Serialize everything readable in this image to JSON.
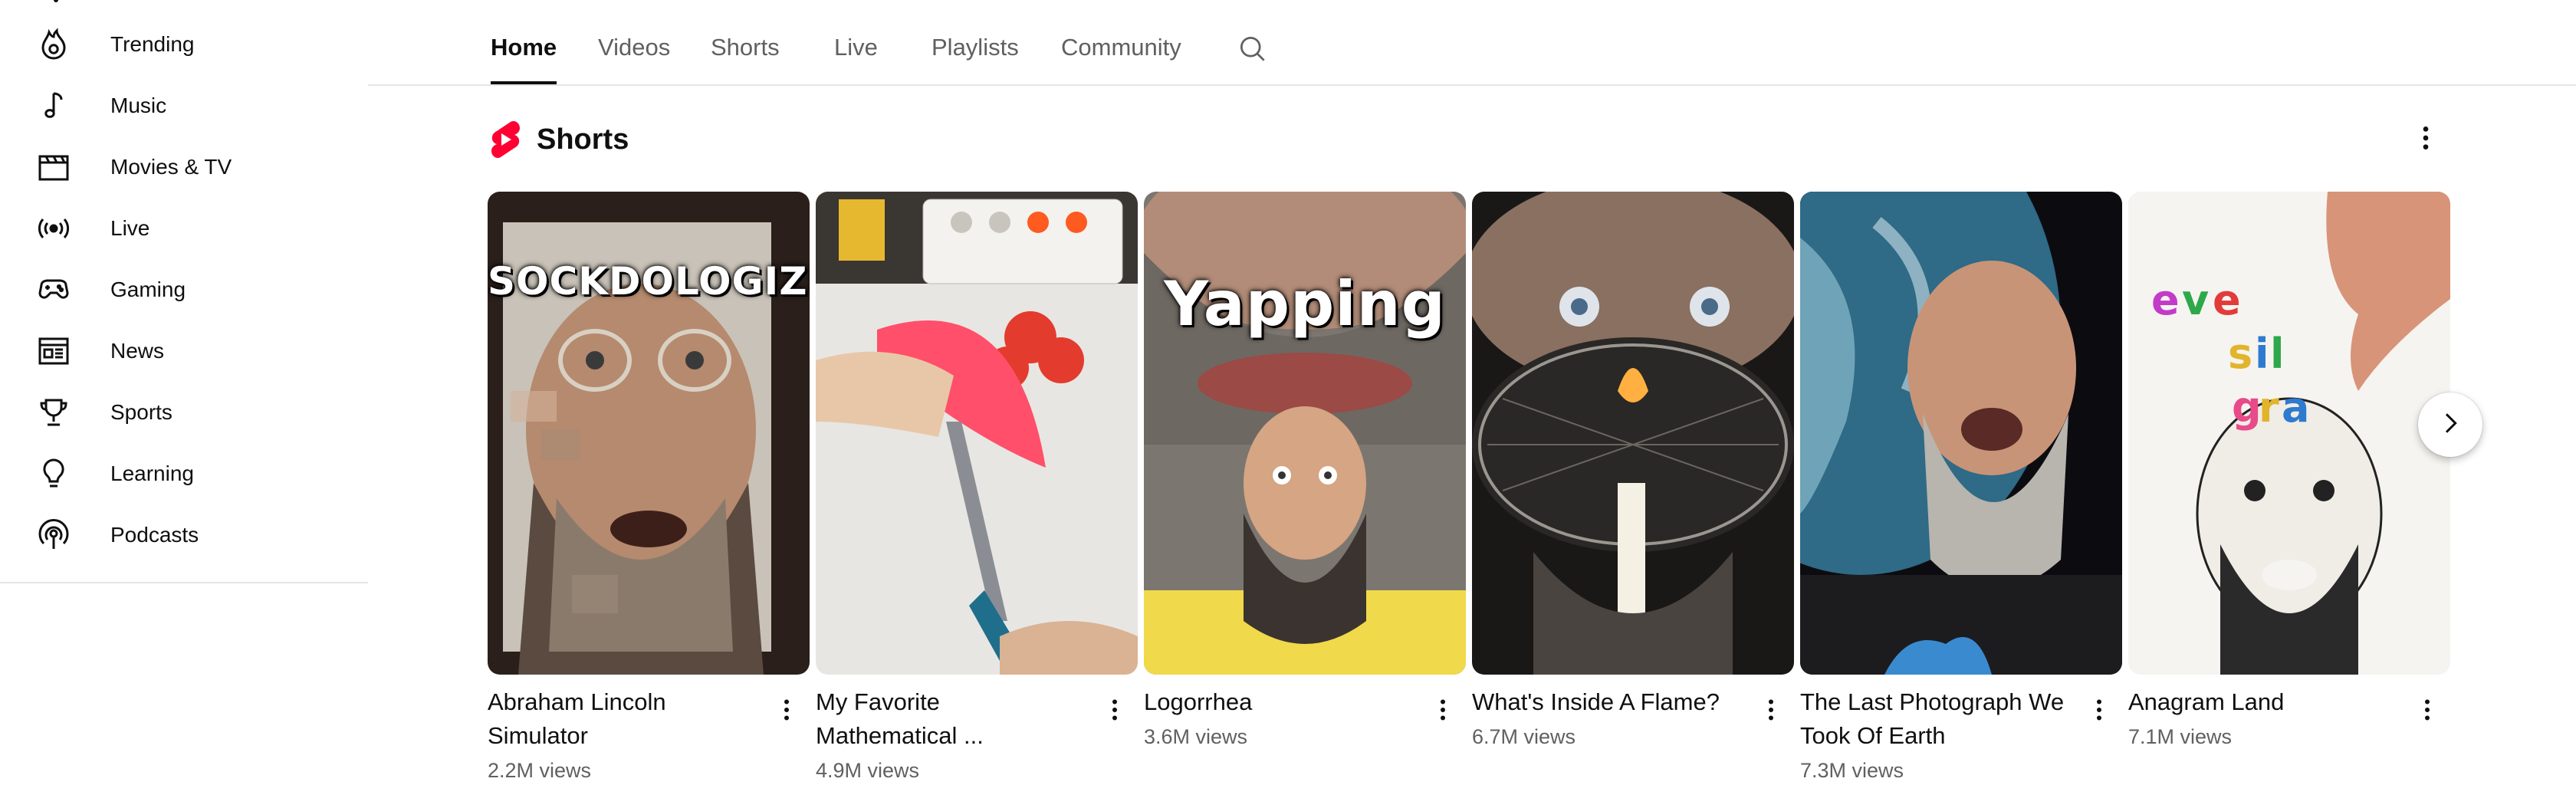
{
  "sidebar": {
    "items": [
      {
        "label": "Trending",
        "icon": "trending-flame-icon"
      },
      {
        "label": "Music",
        "icon": "music-note-icon"
      },
      {
        "label": "Movies & TV",
        "icon": "clapperboard-icon"
      },
      {
        "label": "Live",
        "icon": "live-broadcast-icon"
      },
      {
        "label": "Gaming",
        "icon": "game-controller-icon"
      },
      {
        "label": "News",
        "icon": "newspaper-icon"
      },
      {
        "label": "Sports",
        "icon": "trophy-icon"
      },
      {
        "label": "Learning",
        "icon": "lightbulb-icon"
      },
      {
        "label": "Podcasts",
        "icon": "podcast-icon"
      }
    ]
  },
  "tabs": [
    "Home",
    "Videos",
    "Shorts",
    "Live",
    "Playlists",
    "Community"
  ],
  "active_tab": "Home",
  "shelf": {
    "title": "Shorts",
    "accent": "#ff0033"
  },
  "shorts": [
    {
      "title": "Abraham Lincoln Simulator",
      "views": "2.2M views",
      "overlay": "SOCKDOLOGIZING"
    },
    {
      "title": "My Favorite Mathematical ...",
      "views": "4.9M views",
      "overlay": ""
    },
    {
      "title": "Logorrhea",
      "views": "3.6M views",
      "overlay": "Yapping"
    },
    {
      "title": "What's Inside A Flame?",
      "views": "6.7M views",
      "overlay": ""
    },
    {
      "title": "The Last Photograph We Took Of Earth",
      "views": "7.3M views",
      "overlay": ""
    },
    {
      "title": "Anagram Land",
      "views": "7.1M views",
      "overlay": "eve sil gra"
    }
  ],
  "colors": {
    "text_primary": "#0f0f0f",
    "text_secondary": "#606060",
    "divider": "#e5e5e5",
    "shorts_red": "#ff0033"
  }
}
